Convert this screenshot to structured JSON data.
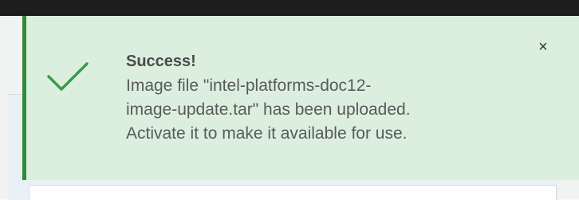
{
  "toast": {
    "title": "Success!",
    "message_lines": [
      "Image file \"intel-platforms-doc12-",
      "image-update.tar\" has been uploaded.",
      "Activate it to make it available for use."
    ],
    "close_label": "×",
    "icon": "check-icon"
  },
  "colors": {
    "success_accent": "#2e8b3a",
    "toast_background": "#dcefdf",
    "check_color": "#3a9a4b"
  }
}
